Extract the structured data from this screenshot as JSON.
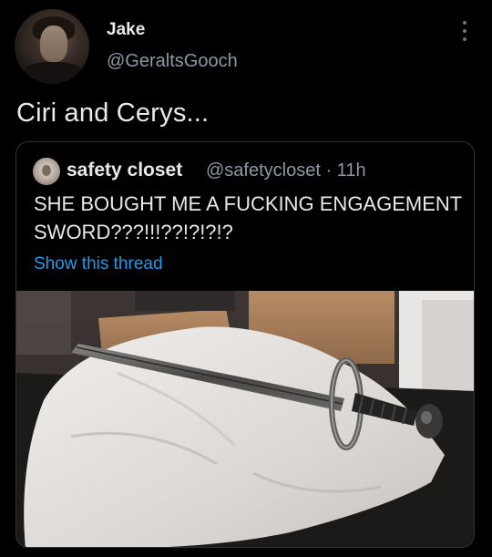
{
  "tweet": {
    "author": {
      "display_name": "Jake",
      "handle": "@GeraltsGooch"
    },
    "text": "Ciri and Cerys...",
    "more_icon": "more-dots-icon"
  },
  "quote": {
    "author": {
      "display_name": "safety closet",
      "handle_and_time": "@safetycloset · 11h"
    },
    "text": "SHE BOUGHT ME A FUCKING ENGAGEMENT SWORD???!!!??!?!?!?",
    "show_thread_label": "Show this thread",
    "link_color": "#1d9bf0"
  },
  "colors": {
    "background": "#000000",
    "primary_text": "#e7e9ea",
    "secondary_text": "#8b98a5",
    "border": "#2f3336"
  }
}
